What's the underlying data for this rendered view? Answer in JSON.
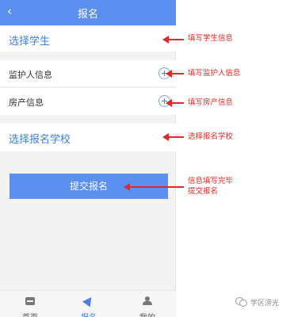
{
  "header": {
    "back_icon": "‹",
    "title": "报名"
  },
  "form": {
    "select_student": "选择学生",
    "guardian_info": "监护人信息",
    "house_info": "房产信息",
    "select_school": "选择报名学校",
    "submit_label": "提交报名",
    "add_icon": "plus-circle-icon"
  },
  "tabbar": {
    "items": [
      {
        "label": "首页",
        "icon": "home-icon"
      },
      {
        "label": "报名",
        "icon": "send-icon",
        "active": true
      },
      {
        "label": "我的",
        "icon": "user-icon"
      }
    ]
  },
  "annotations": {
    "student": "填写学生信息",
    "guardian": "填写监护人信息",
    "house": "填写房产信息",
    "school": "选择报名学校",
    "submit_line1": "信息填写完毕",
    "submit_line2": "提交报名"
  },
  "watermark": "学区涝光",
  "colors": {
    "primary": "#5b8ff0",
    "link": "#3f7fe0",
    "annotation": "#e02a2a",
    "page_bg": "#f3f3f3"
  }
}
